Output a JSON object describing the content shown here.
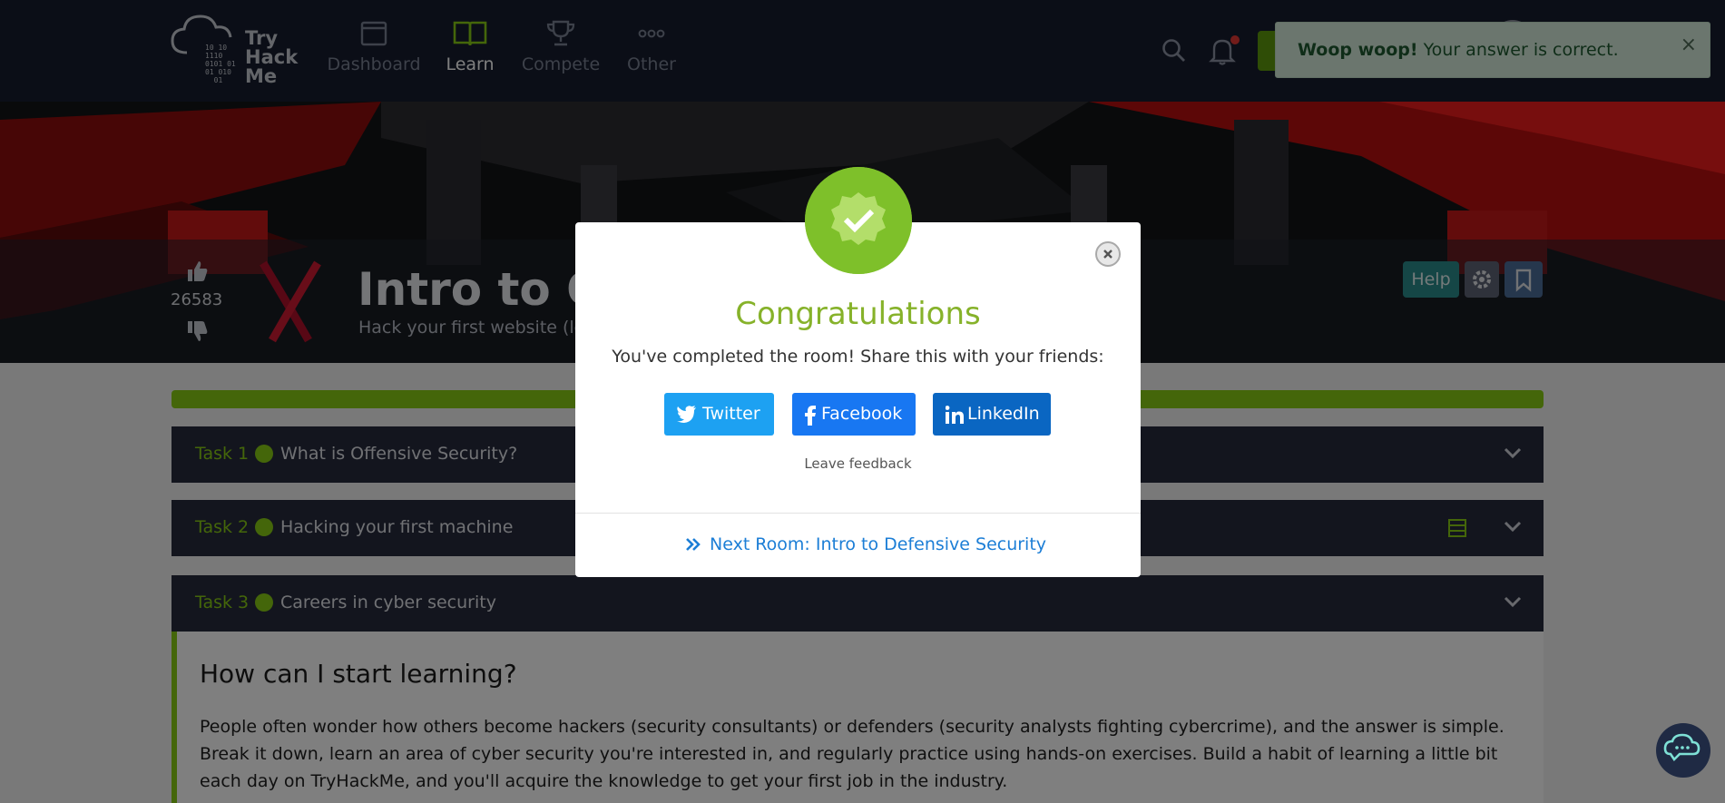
{
  "brand": {
    "logo_line1": "Try",
    "logo_line2": "Hack",
    "logo_line3": "Me",
    "logo_binary": "10 10\n1110\n0101 01\n01 010\n  01"
  },
  "nav": {
    "items": [
      {
        "label": "Dashboard",
        "icon": "dashboard-icon"
      },
      {
        "label": "Learn",
        "icon": "book-icon",
        "active": true
      },
      {
        "label": "Compete",
        "icon": "trophy-icon"
      },
      {
        "label": "Other",
        "icon": "more-dots-icon"
      }
    ]
  },
  "toast": {
    "strong": "Woop woop!",
    "text": " Your answer is correct.",
    "close": "×"
  },
  "room": {
    "votes": "26583",
    "title": "Intro to Of",
    "subtitle": "Hack your first website (le",
    "help_label": "Help"
  },
  "tasks": [
    {
      "label": "Task 1",
      "title": "What is Offensive Security?"
    },
    {
      "label": "Task 2",
      "title": "Hacking your first machine"
    },
    {
      "label": "Task 3",
      "title": "Careers in cyber security"
    }
  ],
  "task_body": {
    "heading": "How can I start learning?",
    "paragraph": "People often wonder how others become hackers (security consultants) or defenders (security analysts fighting cybercrime), and the answer is simple. Break it down, learn an area of cyber security you're interested in, and regularly practice using hands-on exercises. Build a habit of learning a little bit each day on TryHackMe, and you'll acquire the knowledge to get your first job in the industry."
  },
  "modal": {
    "title": "Congratulations",
    "text": "You've completed the room! Share this with your friends:",
    "share": [
      {
        "label": "Twitter",
        "icon": "twitter-icon"
      },
      {
        "label": "Facebook",
        "icon": "facebook-icon"
      },
      {
        "label": "LinkedIn",
        "icon": "linkedin-icon"
      }
    ],
    "feedback": "Leave feedback",
    "next_room": "Next Room: Intro to Defensive Security"
  },
  "colors": {
    "accent_green": "#88cc14",
    "nav_bg": "#171d2e",
    "task_bg": "#262b3d",
    "twitter": "#1da1f2",
    "facebook": "#1877f2",
    "linkedin": "#0a66c2",
    "link_blue": "#1c7ed6"
  }
}
